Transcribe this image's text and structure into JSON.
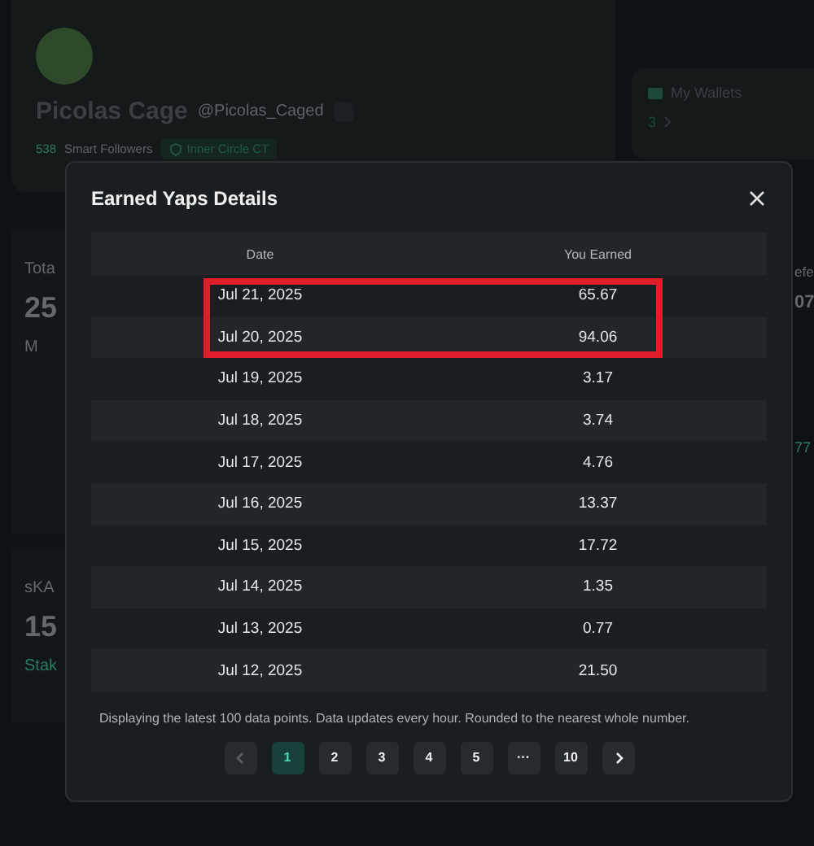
{
  "profile": {
    "name": "Picolas Cage",
    "handle": "@Picolas_Caged",
    "followers_count": "538",
    "followers_label": "Smart Followers",
    "badge": "Inner Circle CT"
  },
  "wallets": {
    "title": "My Wallets",
    "count": "3"
  },
  "left_cards": [
    {
      "label": "Tota",
      "value": "25",
      "sub": "M"
    },
    {
      "label": "sKA",
      "value": "15",
      "sub": "Stak"
    }
  ],
  "right_fragments": {
    "label": "efe",
    "value": "07",
    "sub": "77"
  },
  "modal": {
    "title": "Earned Yaps Details",
    "columns": [
      "Date",
      "You Earned"
    ],
    "rows": [
      {
        "date": "Jul 21, 2025",
        "earned": "65.67",
        "highlighted": true
      },
      {
        "date": "Jul 20, 2025",
        "earned": "94.06",
        "highlighted": true
      },
      {
        "date": "Jul 19, 2025",
        "earned": "3.17",
        "highlighted": false
      },
      {
        "date": "Jul 18, 2025",
        "earned": "3.74",
        "highlighted": false
      },
      {
        "date": "Jul 17, 2025",
        "earned": "4.76",
        "highlighted": false
      },
      {
        "date": "Jul 16, 2025",
        "earned": "13.37",
        "highlighted": false
      },
      {
        "date": "Jul 15, 2025",
        "earned": "17.72",
        "highlighted": false
      },
      {
        "date": "Jul 14, 2025",
        "earned": "1.35",
        "highlighted": false
      },
      {
        "date": "Jul 13, 2025",
        "earned": "0.77",
        "highlighted": false
      },
      {
        "date": "Jul 12, 2025",
        "earned": "21.50",
        "highlighted": false
      }
    ],
    "footnote": "Displaying the latest 100 data points. Data updates every hour. Rounded to the nearest whole number.",
    "pagination": [
      {
        "kind": "prev",
        "disabled": true
      },
      {
        "kind": "page",
        "label": "1",
        "selected": true
      },
      {
        "kind": "page",
        "label": "2",
        "selected": false
      },
      {
        "kind": "page",
        "label": "3",
        "selected": false
      },
      {
        "kind": "page",
        "label": "4",
        "selected": false
      },
      {
        "kind": "page",
        "label": "5",
        "selected": false
      },
      {
        "kind": "ellipsis",
        "label": "···"
      },
      {
        "kind": "page",
        "label": "10",
        "selected": false
      },
      {
        "kind": "next",
        "disabled": false
      }
    ]
  }
}
